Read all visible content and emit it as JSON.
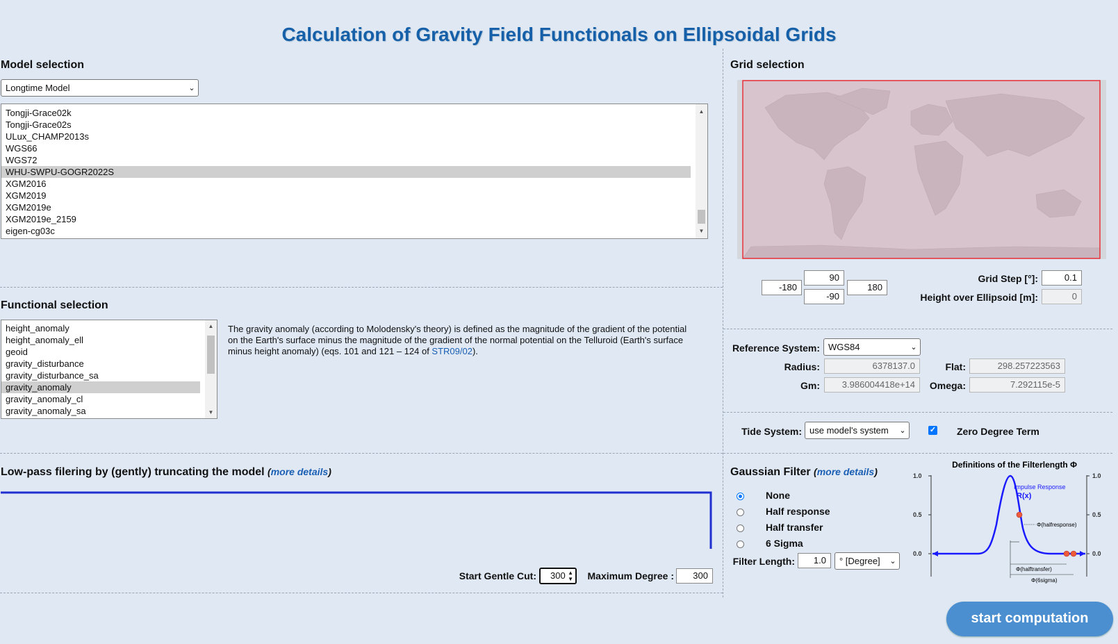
{
  "page": {
    "title": "Calculation of Gravity Field Functionals on Ellipsoidal Grids"
  },
  "model": {
    "section_title": "Model selection",
    "type_select": "Longtime Model",
    "items": [
      "Tongji-Grace02k",
      "Tongji-Grace02s",
      "ULux_CHAMP2013s",
      "WGS66",
      "WGS72",
      "WHU-SWPU-GOGR2022S",
      "XGM2016",
      "XGM2019",
      "XGM2019e",
      "XGM2019e_2159",
      "eigen-cg03c"
    ],
    "selected": "WHU-SWPU-GOGR2022S"
  },
  "functional": {
    "section_title": "Functional selection",
    "items": [
      "height_anomaly",
      "height_anomaly_ell",
      "geoid",
      "gravity_disturbance",
      "gravity_disturbance_sa",
      "gravity_anomaly",
      "gravity_anomaly_cl",
      "gravity_anomaly_sa"
    ],
    "selected": "gravity_anomaly",
    "desc_text": "The gravity anomaly (according to Molodensky's theory) is defined as the magnitude of the gradient of the potential on the Earth's surface minus the magnitude of the gradient of the normal potential on the Telluroid (Earth's surface minus height anomaly) (eqs. 101 and 121 – 124 of ",
    "desc_link": "STR09/02",
    "desc_end": ")."
  },
  "grid": {
    "section_title": "Grid selection",
    "north": "90",
    "south": "-90",
    "west": "-180",
    "east": "180",
    "step_label": "Grid Step [°]:",
    "step_value": "0.1",
    "height_label": "Height over Ellipsoid [m]:",
    "height_value": "0"
  },
  "reference": {
    "system_label": "Reference System:",
    "system_value": "WGS84",
    "radius_label": "Radius:",
    "radius_value": "6378137.0",
    "flat_label": "Flat:",
    "flat_value": "298.257223563",
    "gm_label": "Gm:",
    "gm_value": "3.986004418e+14",
    "omega_label": "Omega:",
    "omega_value": "7.292115e-5"
  },
  "tide": {
    "label": "Tide System:",
    "value": "use model's system",
    "zero_degree_label": "Zero Degree Term",
    "zero_degree_checked": true
  },
  "lowpass": {
    "section_title": "Low-pass filering by (gently) truncating the model",
    "more_details": "more details",
    "start_cut_label": "Start Gentle Cut:",
    "start_cut_value": "300",
    "max_degree_label": "Maximum Degree :",
    "max_degree_value": "300"
  },
  "gaussian": {
    "section_title": "Gaussian Filter",
    "more_details": "more details",
    "options": [
      "None",
      "Half response",
      "Half transfer",
      "6 Sigma"
    ],
    "selected": "None",
    "length_label": "Filter Length:",
    "length_value": "1.0",
    "unit_value": "° [Degree]"
  },
  "filter_diagram": {
    "title": "Definitions of the Filterlength Φ",
    "impulse_label": "Impulse Response",
    "rx_label": "R(x)",
    "y_ticks": [
      "1.0",
      "0.5",
      "0.0"
    ],
    "halfresponse_label": "Φ(halfresponse)",
    "halftransfer_label": "Φ(halftransfer)",
    "sixsigma_label": "Φ(6sigma)",
    "curve_color": "#1a1aff",
    "marker_color": "#ef5a3a"
  },
  "actions": {
    "start": "start computation"
  },
  "icons": {
    "dropdown": "chevron-down-icon",
    "scroll_up": "scroll-up-arrow-icon",
    "scroll_down": "scroll-down-arrow-icon"
  }
}
